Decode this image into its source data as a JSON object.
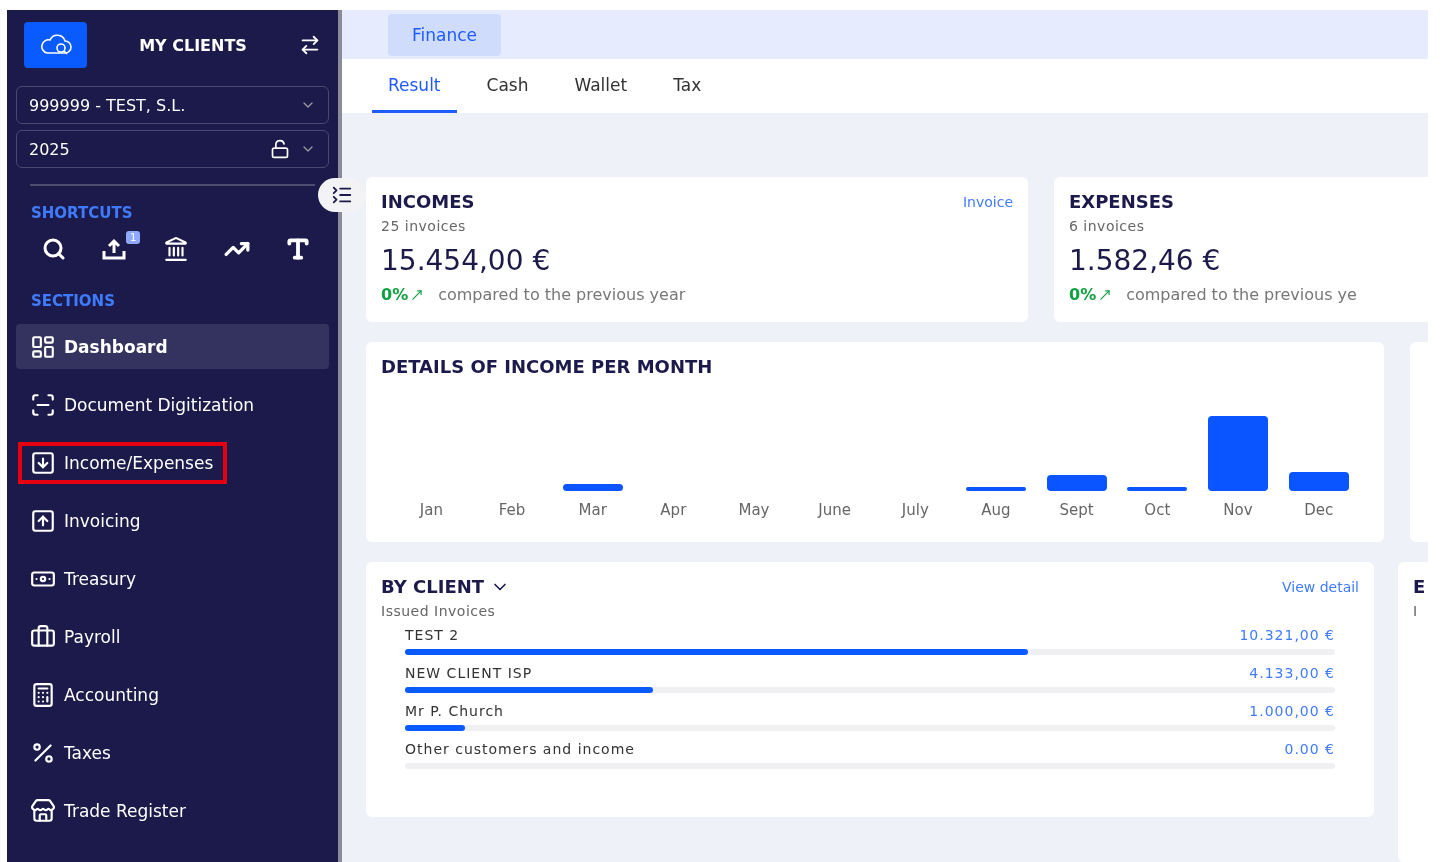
{
  "sidebar": {
    "title": "MY CLIENTS",
    "company_select": {
      "value": "999999 - TEST, S.L."
    },
    "year_select": {
      "value": "2025",
      "locked": false
    },
    "shortcuts": {
      "heading": "SHORTCUTS",
      "upload_badge": "1"
    },
    "sections": {
      "heading": "SECTIONS",
      "items": [
        {
          "label": "Dashboard",
          "selected": true,
          "highlighted": false
        },
        {
          "label": "Document Digitization",
          "selected": false,
          "highlighted": false
        },
        {
          "label": "Income/Expenses",
          "selected": false,
          "highlighted": true
        },
        {
          "label": "Invoicing",
          "selected": false,
          "highlighted": false
        },
        {
          "label": "Treasury",
          "selected": false,
          "highlighted": false
        },
        {
          "label": "Payroll",
          "selected": false,
          "highlighted": false
        },
        {
          "label": "Accounting",
          "selected": false,
          "highlighted": false
        },
        {
          "label": "Taxes",
          "selected": false,
          "highlighted": false
        },
        {
          "label": "Trade Register",
          "selected": false,
          "highlighted": false
        }
      ]
    }
  },
  "top_tabs": [
    {
      "label": "Finance",
      "selected": true
    }
  ],
  "tabs": [
    {
      "label": "Result",
      "selected": true
    },
    {
      "label": "Cash",
      "selected": false
    },
    {
      "label": "Wallet",
      "selected": false
    },
    {
      "label": "Tax",
      "selected": false
    }
  ],
  "summary_cards": [
    {
      "title": "INCOMES",
      "subtitle": "25 invoices",
      "link": "Invoice",
      "amount": "15.454,00 €",
      "change": "0%",
      "comparison": "compared to the previous year"
    },
    {
      "title": "EXPENSES",
      "subtitle": "6 invoices",
      "amount": "1.582,46 €",
      "change": "0%",
      "comparison": "compared to the previous ye"
    }
  ],
  "income_chart": {
    "title": "DETAILS OF INCOME PER MONTH",
    "months": [
      "Jan",
      "Feb",
      "Mar",
      "Apr",
      "May",
      "June",
      "July",
      "Aug",
      "Sept",
      "Oct",
      "Nov",
      "Dec"
    ]
  },
  "by_client": {
    "title": "BY CLIENT",
    "subtitle": "Issued Invoices",
    "link": "View detail",
    "rows": [
      {
        "name": "TEST 2",
        "amount": "10.321,00 €",
        "level": 0.67
      },
      {
        "name": "NEW CLIENT ISP",
        "amount": "4.133,00 €",
        "level": 0.267
      },
      {
        "name": "Mr P. Church",
        "amount": "1.000,00 €",
        "level": 0.065
      },
      {
        "name": "Other customers and income",
        "amount": "0.00 €",
        "level": 0
      }
    ]
  },
  "side_card": {
    "title": "E",
    "subtitle": "I"
  }
}
